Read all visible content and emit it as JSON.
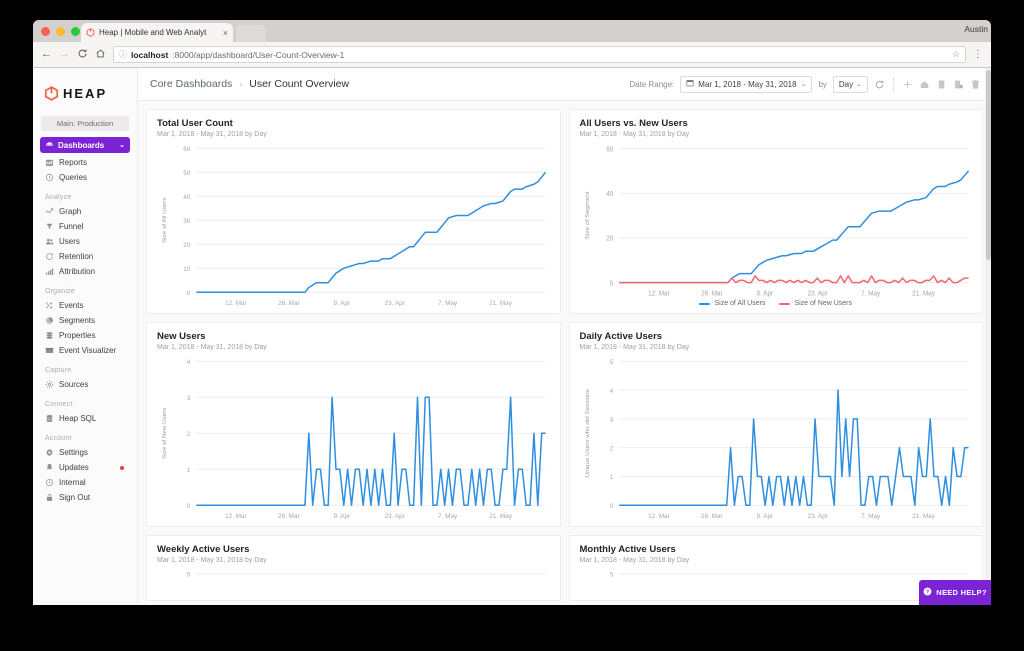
{
  "browser": {
    "tab_title": "Heap | Mobile and Web Analyt",
    "tab_close": "×",
    "back_icon": "←",
    "forward_icon": "→",
    "reload_icon": "C",
    "home_icon": "⌂",
    "url_info_icon": "ⓘ",
    "url_host": "localhost",
    "url_path": ":8000/app/dashboard/User-Count-Overview-1",
    "star_icon": "☆",
    "menu_icon": "⋮",
    "user_label": "Austin"
  },
  "sidebar": {
    "logo_text": "HEAP",
    "env": "Main: Production",
    "active_item": {
      "label": "Dashboards",
      "icon": "dashboards-icon",
      "chevron": "⌄"
    },
    "items": [
      {
        "label": "Reports",
        "icon": "reports-icon"
      },
      {
        "label": "Queries",
        "icon": "queries-icon"
      }
    ],
    "groups": [
      {
        "title": "Analyze",
        "items": [
          {
            "label": "Graph",
            "icon": "graph-icon"
          },
          {
            "label": "Funnel",
            "icon": "funnel-icon"
          },
          {
            "label": "Users",
            "icon": "users-icon"
          },
          {
            "label": "Retention",
            "icon": "retention-icon"
          },
          {
            "label": "Attribution",
            "icon": "attribution-icon"
          }
        ]
      },
      {
        "title": "Organize",
        "items": [
          {
            "label": "Events",
            "icon": "events-icon"
          },
          {
            "label": "Segments",
            "icon": "segments-icon"
          },
          {
            "label": "Properties",
            "icon": "properties-icon"
          },
          {
            "label": "Event Visualizer",
            "icon": "event-visualizer-icon"
          }
        ]
      },
      {
        "title": "Capture",
        "items": [
          {
            "label": "Sources",
            "icon": "sources-icon"
          }
        ]
      },
      {
        "title": "Connect",
        "items": [
          {
            "label": "Heap SQL",
            "icon": "database-icon"
          }
        ]
      },
      {
        "title": "Account",
        "items": [
          {
            "label": "Settings",
            "icon": "gear-icon"
          },
          {
            "label": "Updates",
            "icon": "bell-icon",
            "badge": true
          },
          {
            "label": "Internal",
            "icon": "clock-icon"
          },
          {
            "label": "Sign Out",
            "icon": "lock-icon"
          }
        ]
      }
    ]
  },
  "topbar": {
    "breadcrumb_parent": "Core Dashboards",
    "breadcrumb_sep": "›",
    "breadcrumb_current": "User Count Overview",
    "date_range_label": "Date Range:",
    "date_range_value": "Mar 1, 2018 - May 31, 2018",
    "calendar_icon": "▦",
    "chevron": "⌄",
    "by_label": "by",
    "granularity_value": "Day",
    "icons": [
      {
        "name": "refresh-icon"
      },
      {
        "name": "add-icon"
      },
      {
        "name": "home-icon"
      },
      {
        "name": "duplicate-icon"
      },
      {
        "name": "copy-to-icon"
      },
      {
        "name": "trash-icon"
      }
    ]
  },
  "need_help": {
    "label": "NEED HELP?",
    "icon": "question-icon"
  },
  "colors": {
    "accent_purple": "#7B24D6",
    "logo_orange": "#F1603C",
    "series_blue": "#2E8FE0",
    "series_red": "#F2676B",
    "badge_red": "#EC3B43"
  },
  "chart_data": [
    {
      "type": "line",
      "title": "Total User Count",
      "subtitle": "Mar 1, 2018 - May 31, 2018 by Day",
      "ylabel": "Size of All Users",
      "xlabel": "",
      "ylim": [
        0,
        60
      ],
      "yticks": [
        0,
        10,
        20,
        30,
        40,
        50,
        60
      ],
      "xticks": [
        "12. Mar",
        "26. Mar",
        "9. Apr",
        "23. Apr",
        "7. May",
        "21. May"
      ],
      "grid": true,
      "legend": null,
      "series": [
        {
          "name": "Size of All Users",
          "color": "#2E8FE0",
          "values": [
            0,
            0,
            0,
            0,
            0,
            0,
            0,
            0,
            0,
            0,
            0,
            0,
            0,
            0,
            0,
            0,
            0,
            0,
            0,
            0,
            0,
            0,
            0,
            0,
            0,
            0,
            0,
            0,
            0,
            2,
            3,
            4,
            4,
            4,
            4,
            6,
            8,
            9,
            10,
            10.5,
            11,
            11.5,
            12,
            12,
            12.5,
            13,
            13,
            13,
            14,
            14,
            14,
            15,
            16,
            17,
            18,
            19,
            19,
            21,
            23,
            25,
            25,
            25,
            25,
            27,
            29,
            31,
            31.5,
            32,
            32,
            32,
            32,
            33,
            34,
            35,
            36,
            36.5,
            37,
            37,
            37.5,
            38,
            40,
            42,
            43,
            43,
            43,
            44,
            44.5,
            45,
            46,
            48,
            50
          ]
        }
      ]
    },
    {
      "type": "line",
      "title": "All Users vs. New Users",
      "subtitle": "Mar 1, 2018 - May 31, 2018 by Day",
      "ylabel": "Size of Segment",
      "xlabel": "",
      "ylim": [
        0,
        60
      ],
      "yticks": [
        0,
        20,
        40,
        60
      ],
      "xticks": [
        "12. Mar",
        "26. Mar",
        "9. Apr",
        "23. Apr",
        "7. May",
        "21. May"
      ],
      "grid": true,
      "legend": {
        "position": "bottom"
      },
      "series": [
        {
          "name": "Size of All Users",
          "color": "#2E8FE0",
          "values": [
            0,
            0,
            0,
            0,
            0,
            0,
            0,
            0,
            0,
            0,
            0,
            0,
            0,
            0,
            0,
            0,
            0,
            0,
            0,
            0,
            0,
            0,
            0,
            0,
            0,
            0,
            0,
            0,
            0,
            2,
            3,
            4,
            4,
            4,
            4,
            6,
            8,
            9,
            10,
            10.5,
            11,
            11.5,
            12,
            12,
            12.5,
            13,
            13,
            13,
            14,
            14,
            14,
            15,
            16,
            17,
            18,
            19,
            19,
            21,
            23,
            25,
            25,
            25,
            25,
            27,
            29,
            31,
            31.5,
            32,
            32,
            32,
            32,
            33,
            34,
            35,
            36,
            36.5,
            37,
            37,
            37.5,
            38,
            40,
            42,
            43,
            43,
            43,
            44,
            44.5,
            45,
            46,
            48,
            50
          ]
        },
        {
          "name": "Size of New Users",
          "color": "#F2676B",
          "values": [
            0,
            0,
            0,
            0,
            0,
            0,
            0,
            0,
            0,
            0,
            0,
            0,
            0,
            0,
            0,
            0,
            0,
            0,
            0,
            0,
            0,
            0,
            0,
            0,
            0,
            0,
            0,
            0,
            0,
            2,
            0,
            1,
            1,
            0,
            0,
            3,
            1,
            1,
            0,
            1,
            0,
            1,
            1,
            0,
            1,
            0,
            1,
            0,
            1,
            0,
            0,
            2,
            0,
            1,
            1,
            0,
            0,
            3,
            0,
            3,
            0,
            0,
            0,
            1,
            0,
            3,
            0,
            1,
            1,
            0,
            0,
            1,
            0,
            2,
            0,
            1,
            1,
            0,
            0,
            1,
            1,
            3,
            0,
            1,
            0,
            2,
            0,
            0,
            1,
            2,
            2
          ]
        }
      ]
    },
    {
      "type": "line",
      "title": "New Users",
      "subtitle": "Mar 1, 2018 - May 31, 2018 by Day",
      "ylabel": "Size of New Users",
      "xlabel": "",
      "ylim": [
        0,
        4
      ],
      "yticks": [
        0,
        1,
        2,
        3,
        4
      ],
      "xticks": [
        "12. Mar",
        "26. Mar",
        "9. Apr",
        "23. Apr",
        "7. May",
        "21. May"
      ],
      "grid": true,
      "legend": null,
      "series": [
        {
          "name": "Size of New Users",
          "color": "#2E8FE0",
          "values": [
            0,
            0,
            0,
            0,
            0,
            0,
            0,
            0,
            0,
            0,
            0,
            0,
            0,
            0,
            0,
            0,
            0,
            0,
            0,
            0,
            0,
            0,
            0,
            0,
            0,
            0,
            0,
            0,
            0,
            2,
            0,
            1,
            1,
            0,
            0,
            3,
            1,
            1,
            0,
            1,
            0,
            1,
            1,
            0,
            1,
            0,
            1,
            0,
            1,
            0,
            0,
            2,
            0,
            1,
            1,
            0,
            0,
            3,
            0,
            3,
            3,
            0,
            0,
            1,
            0,
            1,
            0,
            1,
            1,
            0,
            0,
            1,
            0,
            1,
            0,
            1,
            1,
            0,
            0,
            1,
            1,
            3,
            0,
            1,
            1,
            0,
            0,
            2,
            0,
            2,
            2
          ]
        }
      ]
    },
    {
      "type": "line",
      "title": "Daily Active Users",
      "subtitle": "Mar 1, 2018 - May 31, 2018 by Day",
      "ylabel": "Unique Users who did Sessions",
      "xlabel": "",
      "ylim": [
        0,
        5
      ],
      "yticks": [
        0,
        1,
        2,
        3,
        4,
        5
      ],
      "xticks": [
        "12. Mar",
        "26. Mar",
        "9. Apr",
        "23. Apr",
        "7. May",
        "21. May"
      ],
      "grid": true,
      "legend": null,
      "series": [
        {
          "name": "Unique Users who did Sessions",
          "color": "#2E8FE0",
          "values": [
            0,
            0,
            0,
            0,
            0,
            0,
            0,
            0,
            0,
            0,
            0,
            0,
            0,
            0,
            0,
            0,
            0,
            0,
            0,
            0,
            0,
            0,
            0,
            0,
            0,
            0,
            0,
            0,
            0,
            2,
            0,
            1,
            1,
            0,
            0,
            3,
            1,
            1,
            0,
            1,
            0,
            1,
            1,
            0,
            1,
            0,
            1,
            0,
            1,
            0,
            0,
            3,
            1,
            1,
            1,
            1,
            0,
            4,
            1,
            3,
            1,
            3,
            3,
            0,
            0,
            1,
            1,
            0,
            1,
            1,
            1,
            0,
            1,
            2,
            1,
            1,
            1,
            0,
            2,
            1,
            1,
            3,
            1,
            1,
            0,
            1,
            0,
            2,
            1,
            1,
            2,
            2
          ]
        }
      ]
    },
    {
      "type": "line",
      "title": "Weekly Active Users",
      "subtitle": "Mar 1, 2018 - May 31, 2018 by Day",
      "ylabel": "",
      "xlabel": "",
      "ylim": [
        0,
        5
      ],
      "yticks": [
        5
      ],
      "xticks": [],
      "grid": true,
      "legend": null,
      "series": []
    },
    {
      "type": "line",
      "title": "Monthly Active Users",
      "subtitle": "Mar 1, 2018 - May 31, 2018 by Day",
      "ylabel": "",
      "xlabel": "",
      "ylim": [
        0,
        5
      ],
      "yticks": [
        5
      ],
      "xticks": [],
      "grid": true,
      "legend": null,
      "series": []
    }
  ]
}
